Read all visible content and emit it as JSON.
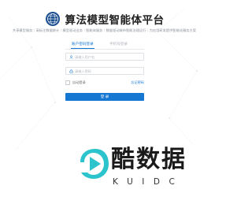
{
  "header": {
    "title": "算法模型智能体平台",
    "subtitle": "共享模型服务｜高标注数据统计｜模型驱动业务｜智能体服务｜数据驱动城市智能治理运行｜为应用研发提供智能化服务方案"
  },
  "tabs": [
    {
      "label": "账户密码登录",
      "active": true
    },
    {
      "label": "手机号登录",
      "active": false
    }
  ],
  "form": {
    "username_placeholder": "请输入用户名",
    "password_placeholder": "请输入密码",
    "remember_label": "自动登录",
    "forgot_label": "忘记密码",
    "login_label": "登 录"
  },
  "watermark": {
    "text": "酷数据",
    "sub": "KUIDC"
  },
  "colors": {
    "accent": "#1677d2",
    "watermark_teal": "#2bc4cc"
  },
  "icons": {
    "emblem": "globe-emblem-icon",
    "user": "user-icon",
    "lock": "lock-icon",
    "watermark_logo": "play-arrow-logo"
  }
}
